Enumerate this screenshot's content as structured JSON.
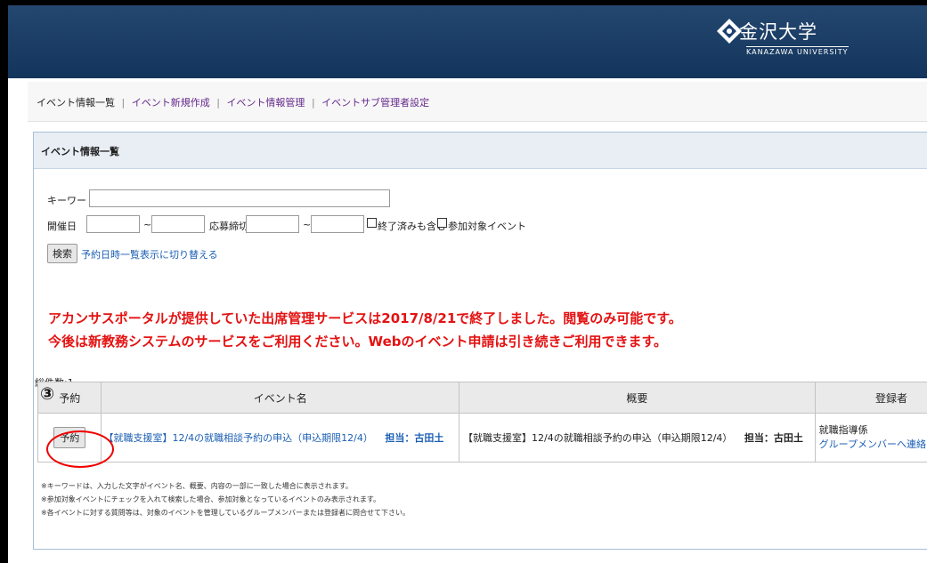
{
  "header": {
    "logo_jp": "金沢大学",
    "logo_en": "KANAZAWA UNIVERSITY",
    "bg_color": "#1a3d66"
  },
  "nav": {
    "items": [
      {
        "label": "イベント情報一覧"
      },
      {
        "label": "イベント新規作成"
      },
      {
        "label": "イベント情報管理"
      },
      {
        "label": "イベントサブ管理者設定"
      }
    ],
    "separator": "|"
  },
  "panel": {
    "title": "イベント情報一覧"
  },
  "search": {
    "keyword_label": "キーワード",
    "keyword_value": "",
    "date_label": "開催日",
    "tilde": "~",
    "deadline_label": "応募締切",
    "include_finished_label": "終了済みも含む",
    "target_event_label": "参加対象イベント",
    "search_button": "検索",
    "switch_link": "予約日時一覧表示に切り替える"
  },
  "notice": {
    "line1": "アカンサスポータルが提供していた出席管理サービスは2017/8/21で終了しました。閲覧のみ可能です。",
    "line2": "今後は新教務システムのサービスをご利用ください。Webのイベント申請は引き続きご利用できます。",
    "color": "#e41212"
  },
  "total": "総件数:1",
  "annotation": {
    "step_number": "③"
  },
  "table": {
    "headers": [
      "予約",
      "イベント名",
      "概要",
      "登録者"
    ],
    "rows": [
      {
        "reserve_button": "予約",
        "event_name": "【就職支援室】12/4の就職相談予約の申込（申込期限12/4）",
        "event_person": "担当：古田土",
        "summary": "【就職支援室】12/4の就職相談予約の申込（申込期限12/4）",
        "summary_person": "担当：古田土",
        "registrant": "就職指導係",
        "contact_link": "グループメンバーへ連絡"
      }
    ]
  },
  "footnotes": [
    "※キーワードは、入力した文字がイベント名、概要、内容の一部に一致した場合に表示されます。",
    "※参加対象イベントにチェックを入れて検索した場合、参加対象となっているイベントのみ表示されます。",
    "※各イベントに対する質問等は、対象のイベントを管理しているグループメンバーまたは登録者に問合せて下さい。"
  ]
}
